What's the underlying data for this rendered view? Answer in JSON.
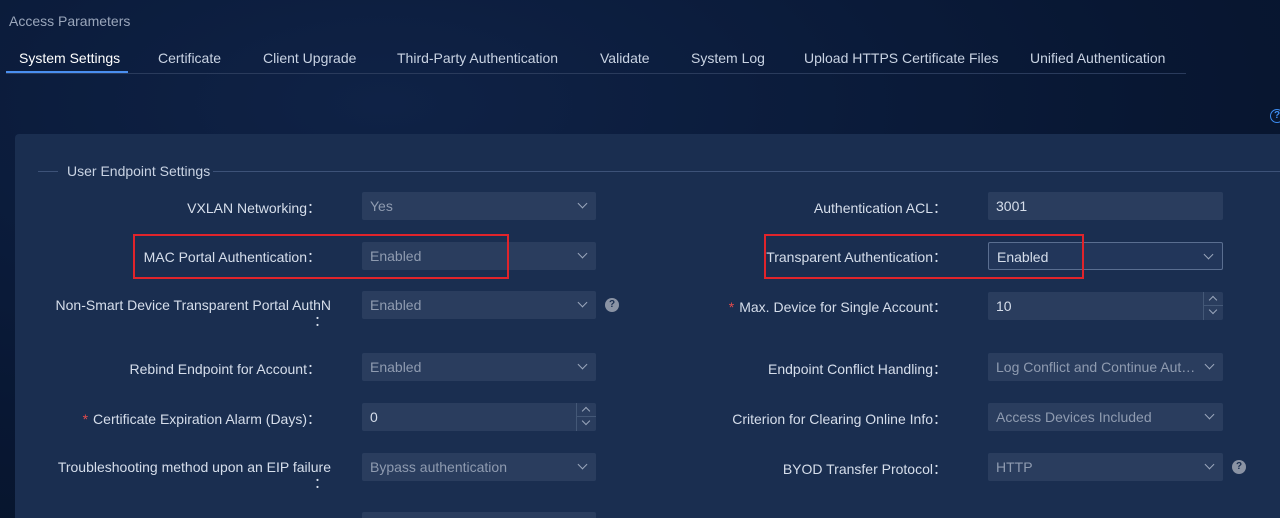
{
  "page_title": "Access Parameters",
  "tabs": [
    {
      "label": "System Settings"
    },
    {
      "label": "Certificate"
    },
    {
      "label": "Client Upgrade"
    },
    {
      "label": "Third-Party Authentication"
    },
    {
      "label": "Validate"
    },
    {
      "label": "System Log"
    },
    {
      "label": "Upload HTTPS Certificate Files"
    },
    {
      "label": "Unified Authentication"
    }
  ],
  "help_icon": "?",
  "section": {
    "title": "User Endpoint Settings"
  },
  "left_fields": [
    {
      "label": "VXLAN Networking：",
      "value": "Yes"
    },
    {
      "label": "MAC Portal Authentication：",
      "value": "Enabled"
    },
    {
      "label": "Non-Smart Device Transparent Portal AuthN",
      "label_tail": "：",
      "value": "Enabled",
      "help": "?"
    },
    {
      "label": "Rebind Endpoint for Account：",
      "value": "Enabled"
    },
    {
      "label": "Certificate Expiration Alarm (Days)：",
      "required": "*",
      "value": "0"
    },
    {
      "label": "Troubleshooting method upon an EIP failure",
      "label_tail": "：",
      "value": "Bypass authentication"
    }
  ],
  "right_fields": [
    {
      "label": "Authentication ACL：",
      "value": "3001"
    },
    {
      "label": "Transparent Authentication：",
      "value": "Enabled"
    },
    {
      "label": "Max. Device for Single Account：",
      "required": "*",
      "value": "10"
    },
    {
      "label": "Endpoint Conflict Handling：",
      "value": "Log Conflict and Continue Auth..."
    },
    {
      "label": "Criterion for Clearing Online Info：",
      "value": "Access Devices Included"
    },
    {
      "label": "BYOD Transfer Protocol：",
      "value": "HTTP",
      "help": "?"
    }
  ],
  "colors": {
    "accent": "#4a8ff0",
    "highlight_box": "#e0242b",
    "required": "#e24b4b"
  }
}
